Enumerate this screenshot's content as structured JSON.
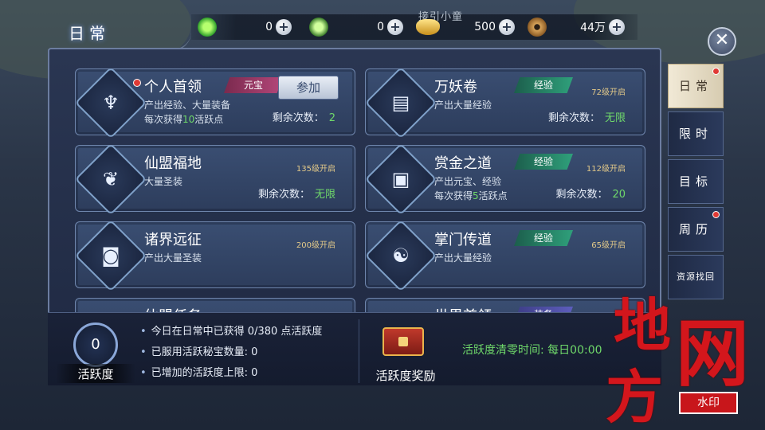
{
  "header": {
    "title": "日常",
    "close_icon": "close-icon"
  },
  "resources": {
    "title_partial": "接引小童",
    "items": [
      {
        "icon": "green-jade-icon",
        "value": "0"
      },
      {
        "icon": "green-jade-bound-icon",
        "value": "0"
      },
      {
        "icon": "gold-ingot-icon",
        "value": "500"
      },
      {
        "icon": "copper-coin-icon",
        "value": "44万"
      }
    ],
    "plus": "+"
  },
  "cards": [
    {
      "name": "个人首领",
      "tag": "元宝",
      "line1": "产出经验、大量装备",
      "line2_pre": "每次获得",
      "line2_num": "10",
      "line2_post": "活跃点",
      "remain_label": "剩余次数：",
      "remain_value": "2",
      "button": "参加",
      "red_dot": true,
      "icon": "demon-mask-icon"
    },
    {
      "name": "万妖卷",
      "tag": "经验",
      "level": "72级开启",
      "line1": "产出大量经验",
      "remain_label": "剩余次数：",
      "remain_value": "无限",
      "icon": "scroll-icon"
    },
    {
      "name": "仙盟福地",
      "level": "135级开启",
      "line1": "大量圣装",
      "remain_label": "剩余次数：",
      "remain_value": "无限",
      "icon": "spirit-flame-icon"
    },
    {
      "name": "赏金之道",
      "tag": "经验",
      "level": "112级开启",
      "line1": "产出元宝、经验",
      "line2_pre": "每次获得",
      "line2_num": "5",
      "line2_post": "活跃点",
      "remain_label": "剩余次数：",
      "remain_value": "20",
      "icon": "treasure-chest-icon"
    },
    {
      "name": "诸界远征",
      "level": "200级开启",
      "line1": "产出大量圣装",
      "icon": "banner-icon"
    },
    {
      "name": "掌门传道",
      "tag": "经验",
      "level": "65级开启",
      "line1": "产出大量经验",
      "icon": "bagua-icon"
    },
    {
      "name": "仙盟任务",
      "icon": "quest-icon"
    },
    {
      "name": "世界首领",
      "tag": "装备",
      "icon": "boss-icon"
    }
  ],
  "bottom": {
    "activity_value": "0",
    "activity_label": "活跃度",
    "info": [
      "今日在日常中已获得 0/380 点活跃度",
      "已服用活跃秘宝数量:   0",
      "已增加的活跃度上限: 0"
    ],
    "reward_label": "活跃度奖励",
    "clear_time": "活跃度清零时间:   每日00:00"
  },
  "side_tabs": [
    {
      "label": "日常",
      "active": true,
      "dot": true
    },
    {
      "label": "限时"
    },
    {
      "label": "目标"
    },
    {
      "label": "周历",
      "dot": true
    },
    {
      "label": "资源找回"
    }
  ],
  "watermark": {
    "chars": [
      "地",
      "网",
      "方"
    ],
    "stamp": "水印"
  }
}
